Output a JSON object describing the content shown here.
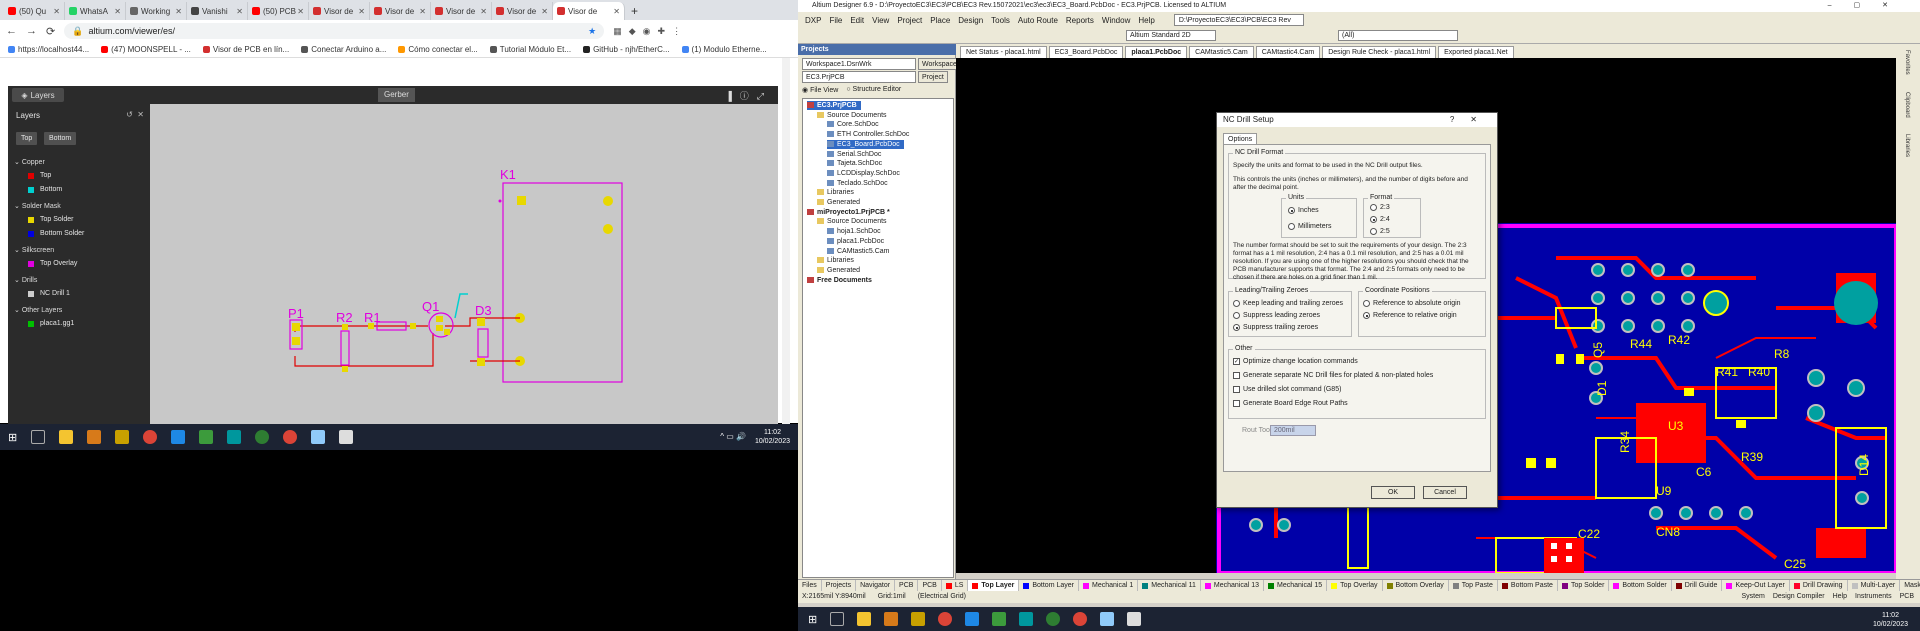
{
  "browser": {
    "tabs": [
      {
        "label": "(50) Qu",
        "color": "#ff0000"
      },
      {
        "label": "WhatsA",
        "color": "#25d366"
      },
      {
        "label": "Working",
        "color": "#666666"
      },
      {
        "label": "Vanishi",
        "color": "#444444"
      },
      {
        "label": "(50) PCB",
        "color": "#ff0000"
      },
      {
        "label": "Visor de",
        "color": "#d32f2f"
      },
      {
        "label": "Visor de",
        "color": "#d32f2f"
      },
      {
        "label": "Visor de",
        "color": "#d32f2f"
      },
      {
        "label": "Visor de",
        "color": "#d32f2f"
      },
      {
        "label": "Visor de",
        "color": "#d32f2f",
        "active": true
      }
    ],
    "url": "altium.com/viewer/es/",
    "bookmarks": [
      {
        "label": "https://localhost44...",
        "color": "#4285f4"
      },
      {
        "label": "(47) MOONSPELL - ...",
        "color": "#ff0000"
      },
      {
        "label": "Visor de PCB en lín...",
        "color": "#d32f2f"
      },
      {
        "label": "Conectar Arduino a...",
        "color": "#555555"
      },
      {
        "label": "Cómo conectar el...",
        "color": "#ff9800"
      },
      {
        "label": "Tutorial Módulo Et...",
        "color": "#555555"
      },
      {
        "label": "GitHub - njh/EtherC...",
        "color": "#222222"
      },
      {
        "label": "(1) Modulo Etherne...",
        "color": "#4285f4"
      }
    ]
  },
  "gerber": {
    "layers_button": "Layers",
    "mode_label": "Gerber",
    "panel_title": "Layers",
    "top_btn": "Top",
    "bottom_btn": "Bottom",
    "groups": [
      {
        "name": "Copper",
        "layers": [
          {
            "name": "Top",
            "color": "#e00000"
          },
          {
            "name": "Bottom",
            "color": "#00d0d0"
          }
        ]
      },
      {
        "name": "Solder Mask",
        "layers": [
          {
            "name": "Top Solder",
            "color": "#e8d800"
          },
          {
            "name": "Bottom Solder",
            "color": "#0000e0"
          }
        ]
      },
      {
        "name": "Silkscreen",
        "layers": [
          {
            "name": "Top Overlay",
            "color": "#e000e0"
          }
        ]
      },
      {
        "name": "Drills",
        "layers": [
          {
            "name": "NC Drill 1",
            "color": "#cccccc"
          }
        ]
      },
      {
        "name": "Other Layers",
        "layers": [
          {
            "name": "placa1.gg1",
            "color": "#00c000"
          }
        ]
      }
    ],
    "designators": {
      "k1": "K1",
      "p1": "P1",
      "r2": "R2",
      "r1": "R1",
      "q1": "Q1",
      "d3": "D3"
    }
  },
  "taskbar_left": {
    "time": "11:02",
    "date": "10/02/2023"
  },
  "altium": {
    "title": "Altium Designer 6.9 - D:\\ProyectoEC3\\EC3\\PCB\\EC3 Rev.15072021\\ec3\\ec3\\EC3_Board.PcbDoc - EC3.PrjPCB. Licensed to ALTIUM",
    "menu": [
      "DXP",
      "File",
      "Edit",
      "View",
      "Project",
      "Place",
      "Design",
      "Tools",
      "Auto Route",
      "Reports",
      "Window",
      "Help"
    ],
    "menu_path": "D:\\ProyectoEC3\\EC3\\PCB\\EC3 Rev",
    "schematic_std": "Altium Standard 2D",
    "filter_all": "(All)",
    "projects_label": "Projects",
    "workspace": "Workspace1.DsnWrk",
    "workspace_btn": "Workspace",
    "project": "EC3.PrjPCB",
    "project_btn": "Project",
    "file_view": "File View",
    "structure_editor": "Structure Editor",
    "tree": [
      {
        "label": "EC3.PrjPCB",
        "level": 0,
        "bold": true,
        "selected": true
      },
      {
        "label": "Source Documents",
        "level": 1
      },
      {
        "label": "Core.SchDoc",
        "level": 2
      },
      {
        "label": "ETH Controller.SchDoc",
        "level": 2
      },
      {
        "label": "EC3_Board.PcbDoc",
        "level": 2,
        "selected": true
      },
      {
        "label": "Serial.SchDoc",
        "level": 2
      },
      {
        "label": "Tajeta.SchDoc",
        "level": 2
      },
      {
        "label": "LCDDisplay.SchDoc",
        "level": 2
      },
      {
        "label": "Teclado.SchDoc",
        "level": 2
      },
      {
        "label": "Libraries",
        "level": 1
      },
      {
        "label": "Generated",
        "level": 1
      },
      {
        "label": "miProyecto1.PrjPCB *",
        "level": 0,
        "bold": true
      },
      {
        "label": "Source Documents",
        "level": 1
      },
      {
        "label": "hoja1.SchDoc",
        "level": 2
      },
      {
        "label": "placa1.PcbDoc",
        "level": 2
      },
      {
        "label": "CAMtastic5.Cam",
        "level": 2
      },
      {
        "label": "Libraries",
        "level": 1
      },
      {
        "label": "Generated",
        "level": 1
      },
      {
        "label": "Free Documents",
        "level": 0,
        "bold": true
      }
    ],
    "doc_tabs": [
      "Net Status - placa1.html",
      "EC3_Board.PcbDoc",
      "placa1.PcbDoc",
      "CAMtastic5.Cam",
      "CAMtastic4.Cam",
      "Design Rule Check - placa1.html",
      "Exported placa1.Net"
    ],
    "panel_tabs": [
      "Files",
      "Projects",
      "Navigator",
      "PCB",
      "PCB"
    ],
    "layers": [
      {
        "name": "LS",
        "color": "#ff0000"
      },
      {
        "name": "Top Layer",
        "color": "#ff0000",
        "active": true
      },
      {
        "name": "Bottom Layer",
        "color": "#0000ff"
      },
      {
        "name": "Mechanical 1",
        "color": "#ff00ff"
      },
      {
        "name": "Mechanical 11",
        "color": "#008080"
      },
      {
        "name": "Mechanical 13",
        "color": "#ff00ff"
      },
      {
        "name": "Mechanical 15",
        "color": "#008000"
      },
      {
        "name": "Top Overlay",
        "color": "#ffff00"
      },
      {
        "name": "Bottom Overlay",
        "color": "#808000"
      },
      {
        "name": "Top Paste",
        "color": "#808080"
      },
      {
        "name": "Bottom Paste",
        "color": "#800000"
      },
      {
        "name": "Top Solder",
        "color": "#800080"
      },
      {
        "name": "Bottom Solder",
        "color": "#ff00ff"
      },
      {
        "name": "Drill Guide",
        "color": "#800000"
      },
      {
        "name": "Keep-Out Layer",
        "color": "#ff00ff"
      },
      {
        "name": "Drill Drawing",
        "color": "#ff002a"
      },
      {
        "name": "Multi-Layer",
        "color": "#c0c0c0"
      },
      {
        "name": "Mask Level"
      },
      {
        "name": "Clear"
      }
    ],
    "status_coords": "X:2165mil Y:8940mil",
    "status_grid": "Grid:1mil",
    "status_elec": "(Electrical Grid)",
    "status_right": [
      "System",
      "Design Compiler",
      "Help",
      "Instruments",
      "PCB"
    ],
    "right_sidebar": [
      "Favorites",
      "Clipboard",
      "Libraries"
    ],
    "pcb_labels": [
      "CN5",
      "R36",
      "D2",
      "D9",
      "CN3",
      "R44",
      "R42",
      "R41",
      "R40",
      "R39",
      "U9",
      "CN8",
      "C22",
      "C25",
      "R34",
      "D1",
      "U3",
      "C6",
      "R8",
      "Q5",
      "D14"
    ]
  },
  "dialog": {
    "title": "NC Drill Setup",
    "help": "?",
    "tab": "Options",
    "format_group": "NC Drill Format",
    "desc1": "Specify the units and format to be used in the NC Drill output files.",
    "desc2": "This controls the units (inches or millimeters), and the number of digits before and after the decimal point.",
    "units_label": "Units",
    "unit_inches": "Inches",
    "unit_mm": "Millimeters",
    "format_label": "Format",
    "format_options": [
      "2:3",
      "2:4",
      "2:5"
    ],
    "desc3": "The number format should be set to suit the requirements of your design. The 2:3 format has a 1 mil resolution, 2:4 has a 0.1 mil resolution, and 2:5 has a 0.01 mil resolution. If you are using one of the higher resolutions you should check that the PCB manufacturer supports that format. The 2:4 and 2:5 formats only need to be chosen if there are holes on a grid finer than 1 mil.",
    "zeroes_label": "Leading/Trailing Zeroes",
    "zero_keep": "Keep leading and trailing zeroes",
    "zero_lead": "Suppress leading zeroes",
    "zero_trail": "Suppress trailing zeroes",
    "coord_label": "Coordinate Positions",
    "coord_abs": "Reference to absolute origin",
    "coord_rel": "Reference to relative origin",
    "other_label": "Other",
    "opt_optimize": "Optimize change location commands",
    "opt_separate": "Generate separate NC Drill files for plated & non-plated holes",
    "opt_slot": "Use drilled slot command (G85)",
    "opt_rout": "Generate Board Edge Rout Paths",
    "rout_label": "Rout Tool Dia",
    "rout_value": "200mil",
    "ok": "OK",
    "cancel": "Cancel"
  },
  "taskbar_right": {
    "time": "11:02",
    "date": "10/02/2023"
  }
}
